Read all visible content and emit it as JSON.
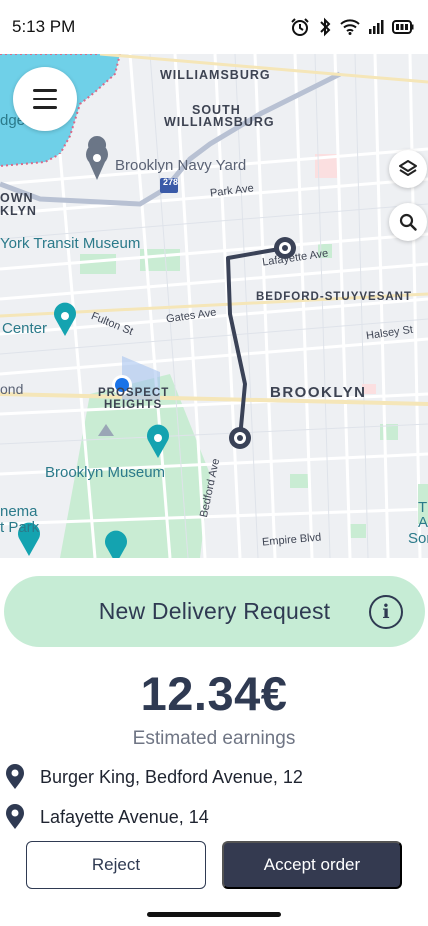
{
  "status_bar": {
    "time": "5:13 PM",
    "icons": [
      "alarm-icon",
      "bluetooth-icon",
      "wifi-icon",
      "signal-icon",
      "battery-icon"
    ]
  },
  "map": {
    "labels": {
      "williamsburg": "WILLIAMSBURG",
      "south_williamsburg_1": "SOUTH",
      "south_williamsburg_2": "WILLIAMSBURG",
      "navy_yard": "Brooklyn Navy Yard",
      "park_ave": "Park Ave",
      "transit_museum": "York Transit Museum",
      "lafayette_ave": "Lafayette Ave",
      "bedford_stuyvesant": "BEDFORD-STUYVESANT",
      "center": "Center",
      "fulton_st": "Fulton St",
      "gates_ave": "Gates Ave",
      "halsey_st": "Halsey St",
      "prospect_heights_1": "PROSPECT",
      "prospect_heights_2": "HEIGHTS",
      "brooklyn": "BROOKLYN",
      "bond": "ond",
      "brooklyn_museum": "Brooklyn Museum",
      "bedford_ave": "Bedford Ave",
      "cinema_1": "nema",
      "cinema_2": "t Park",
      "empire_blvd": "Empire Blvd",
      "highway_shield": "278",
      "left_edge_1": "dge",
      "left_edge_2": "OWN",
      "left_edge_3": "KLYN",
      "right_edge_1": "T",
      "right_edge_2": "A",
      "right_edge_3": "Son"
    },
    "controls": {
      "menu": "menu-icon",
      "layers": "layers-icon",
      "search": "search-icon"
    }
  },
  "request": {
    "title": "New Delivery Request",
    "info_icon": "info-icon"
  },
  "earnings": {
    "amount": "12.34€",
    "label": "Estimated earnings"
  },
  "addresses": [
    {
      "text": "Burger King, Bedford Avenue, 12",
      "icon": "location-pin-icon"
    },
    {
      "text": "Lafayette Avenue, 14",
      "icon": "location-pin-icon"
    }
  ],
  "actions": {
    "reject": "Reject",
    "accept": "Accept order"
  },
  "colors": {
    "accent_dark": "#343a50",
    "banner_green": "#c6ecd5",
    "route": "#3a4257",
    "location_blue": "#1a73e8"
  }
}
